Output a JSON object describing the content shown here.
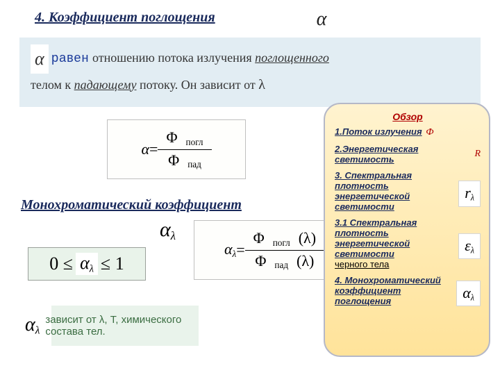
{
  "title": "4. Коэффициент  поглощения",
  "alpha_symbol": "α",
  "definition": {
    "alpha": "α",
    "equals_word": "равен",
    "text1": "  отношению потока излучения  ",
    "absorbed": "поглощенного",
    "text2": "телом  к   ",
    "incident": "падающему",
    "text3": "  потоку. Он зависит от ",
    "lambda": "λ"
  },
  "formula1": {
    "lhs": "α",
    "eq": " = ",
    "num": "Φ",
    "num_sub": "погл",
    "den": "Φ",
    "den_sub": "пад"
  },
  "mono_title": "Монохроматический коэффициент",
  "alpha_lambda": {
    "a": "α",
    "sub": "λ"
  },
  "formula2": {
    "lhs_a": "α",
    "lhs_sub": "λ",
    "eq": " = ",
    "num": "Φ",
    "num_sub": "погл",
    "num_arg": "(λ)",
    "den": "Φ",
    "den_sub": "пад",
    "den_arg": "(λ)"
  },
  "bounds": {
    "lo": "0 ≤ ",
    "a": "α",
    "sub": "λ",
    "hi": " ≤ 1"
  },
  "note": {
    "a": "α",
    "sub": "λ",
    "text": "зависит от λ, Т, химического состава тел."
  },
  "sidebar": {
    "title": "Обзор",
    "items": [
      {
        "label": "1.Поток излучения",
        "sym": "Ф",
        "sym_style": "red"
      },
      {
        "label": "2.Энергетическая светимость",
        "sym": "R",
        "sym_style": "red"
      },
      {
        "label": "3. Спектральная плотность энергетической светимости",
        "sym_a": "r",
        "sym_sub": "λ",
        "sym_style": "box"
      },
      {
        "label": "3.1 Спектральная плотность энергетической светимости",
        "extra": " черного тела",
        "sym_a": "ε",
        "sym_sub": "λ",
        "sym_style": "box"
      },
      {
        "label": "4. Монохроматический коэффициент поглощения",
        "sym_a": "α",
        "sym_sub": "λ",
        "sym_style": "box"
      }
    ]
  }
}
